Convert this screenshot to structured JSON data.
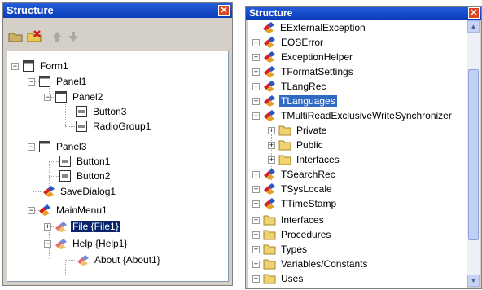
{
  "left_panel": {
    "title": "Structure",
    "close_glyph": "✕",
    "toolbar": [
      {
        "name": "folder-delete-icon"
      },
      {
        "name": "delete-icon"
      },
      {
        "name": "move-up-icon"
      },
      {
        "name": "move-down-icon"
      }
    ],
    "tree": [
      {
        "label": "Form1",
        "icon": "form-icon",
        "expander": "−"
      },
      {
        "label": "Panel1",
        "icon": "panel-icon",
        "expander": "−"
      },
      {
        "label": "Panel2",
        "icon": "panel-icon",
        "expander": "−"
      },
      {
        "label": "Button3",
        "icon": "button-icon",
        "expander": ""
      },
      {
        "label": "RadioGroup1",
        "icon": "button-icon",
        "expander": ""
      },
      {
        "label": "Panel3",
        "icon": "panel-icon",
        "expander": "−"
      },
      {
        "label": "Button1",
        "icon": "button-icon",
        "expander": ""
      },
      {
        "label": "Button2",
        "icon": "button-icon",
        "expander": ""
      },
      {
        "label": "SaveDialog1",
        "icon": "component-icon",
        "expander": ""
      },
      {
        "label": "MainMenu1",
        "icon": "component-icon",
        "expander": "−"
      },
      {
        "label": "File {File1}",
        "icon": "menu-item-icon",
        "expander": "+",
        "selected": true
      },
      {
        "label": "Help {Help1}",
        "icon": "menu-item-icon",
        "expander": "−"
      },
      {
        "label": "About {About1}",
        "icon": "menu-item-icon",
        "expander": ""
      }
    ]
  },
  "right_panel": {
    "title": "Structure",
    "close_glyph": "✕",
    "tree": [
      {
        "label": "EExternalException",
        "icon": "class-icon",
        "expander": ""
      },
      {
        "label": "EOSError",
        "icon": "class-icon",
        "expander": "+"
      },
      {
        "label": "ExceptionHelper",
        "icon": "class-icon",
        "expander": "+"
      },
      {
        "label": "TFormatSettings",
        "icon": "class-icon",
        "expander": "+"
      },
      {
        "label": "TLangRec",
        "icon": "class-icon",
        "expander": "+"
      },
      {
        "label": "TLanguages",
        "icon": "class-icon",
        "expander": "+",
        "selected": true
      },
      {
        "label": "TMultiReadExclusiveWriteSynchronizer",
        "icon": "class-icon",
        "expander": "−"
      },
      {
        "label": "Private",
        "icon": "folder-icon",
        "expander": "+"
      },
      {
        "label": "Public",
        "icon": "folder-icon",
        "expander": "+"
      },
      {
        "label": "Interfaces",
        "icon": "folder-icon",
        "expander": "+"
      },
      {
        "label": "TSearchRec",
        "icon": "class-icon",
        "expander": "+"
      },
      {
        "label": "TSysLocale",
        "icon": "class-icon",
        "expander": "+"
      },
      {
        "label": "TTimeStamp",
        "icon": "class-icon",
        "expander": "+"
      },
      {
        "label": "Interfaces",
        "icon": "folder-icon",
        "expander": "+"
      },
      {
        "label": "Procedures",
        "icon": "folder-icon",
        "expander": "+"
      },
      {
        "label": "Types",
        "icon": "folder-icon",
        "expander": "+"
      },
      {
        "label": "Variables/Constants",
        "icon": "folder-icon",
        "expander": "+"
      },
      {
        "label": "Uses",
        "icon": "folder-icon",
        "expander": "+"
      }
    ],
    "scrollbar": {
      "up_glyph": "▲",
      "down_glyph": "▼"
    }
  },
  "colors": {
    "title_bar": "#245edb",
    "selection": "#0a246a",
    "highlight": "#316ac5",
    "close_button": "#d9461f",
    "window_bg": "#d4d0c8"
  }
}
